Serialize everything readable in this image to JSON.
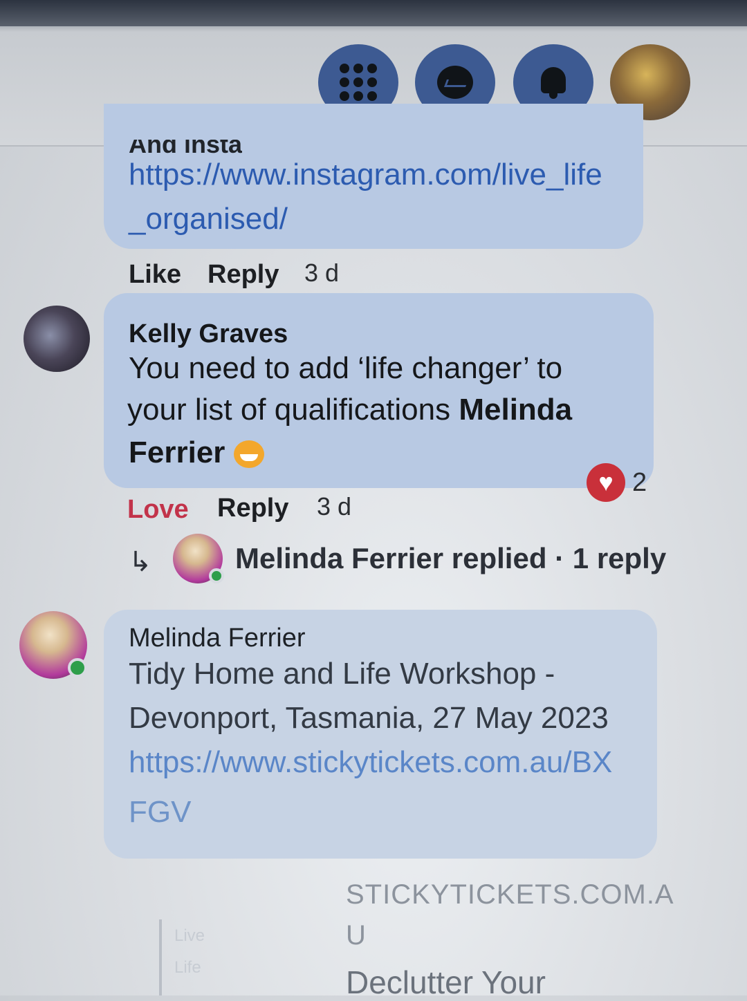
{
  "topbar": {
    "menu_icon": "grid-menu-icon",
    "messenger_icon": "messenger-icon",
    "notifications_icon": "bell-icon",
    "profile_icon": "profile-avatar"
  },
  "comment1": {
    "partial_text": "And insta",
    "link_line1": "https://www.instagram.com/live_life",
    "link_line2": "_organised/",
    "like": "Like",
    "reply": "Reply",
    "time": "3 d"
  },
  "comment2": {
    "author": "Kelly Graves",
    "line1": "You need to add ‘life changer’ to",
    "line2_pre": "your list of qualifications ",
    "line2_bold": "Melinda",
    "line3_bold": "Ferrier",
    "love": "Love",
    "reply": "Reply",
    "time": "3 d",
    "reaction_count": "2",
    "reaction_icon": "heart-icon",
    "replies_text": "Melinda Ferrier replied · 1 reply"
  },
  "comment3": {
    "author": "Melinda Ferrier",
    "line1": "Tidy Home and Life Workshop -",
    "line2": "Devonport, Tasmania, 27 May 2023",
    "link_line1": "https://www.stickytickets.com.au/BX",
    "link_line2": "FGV"
  },
  "preview": {
    "domain_line1": "STICKYTICKETS.COM.A",
    "domain_line2": "U",
    "title": "Declutter Your",
    "faded1": "Live",
    "faded2": "Life"
  }
}
